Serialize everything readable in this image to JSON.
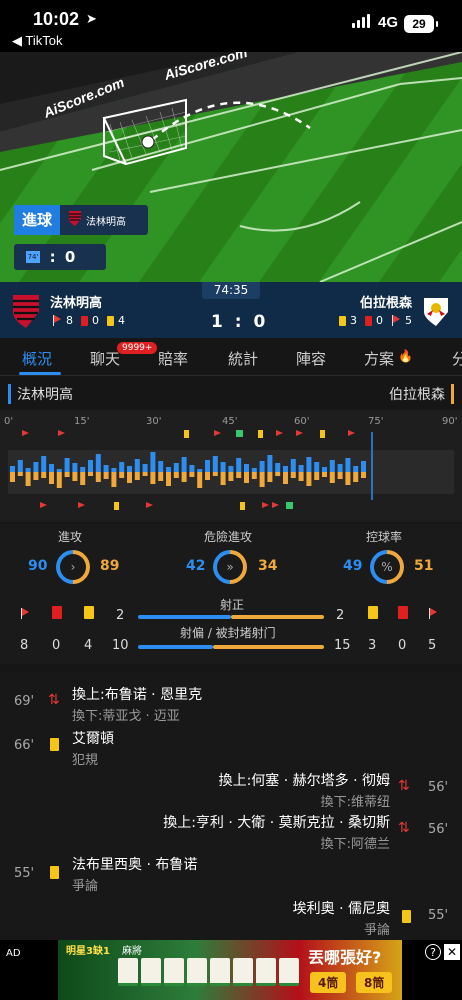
{
  "status": {
    "time": "10:02",
    "back": "◀ TikTok",
    "network": "4G",
    "battery": "29"
  },
  "pitch": {
    "brand_top": "AiScore.com",
    "brand_left": "AiScore.com",
    "event_label": "進球",
    "event_team": "法林明高",
    "minute_badge": "74'",
    "mini_score": "1 : 0"
  },
  "match": {
    "clock": "74:35",
    "home": "法林明高",
    "away": "伯拉根森",
    "score": "1 : 0",
    "home_corners": "8",
    "home_reds": "0",
    "home_yellows": "4",
    "away_yellows": "3",
    "away_reds": "0",
    "away_corners": "5"
  },
  "tabs": [
    {
      "label": "概況"
    },
    {
      "label": "聊天"
    },
    {
      "label": "賠率"
    },
    {
      "label": "統計"
    },
    {
      "label": "陣容"
    },
    {
      "label": "方案"
    },
    {
      "label": "分"
    }
  ],
  "chat_badge": "9999+",
  "teams": {
    "home": "法林明高",
    "away": "伯拉根森"
  },
  "timeline": {
    "ticks": [
      "0'",
      "15'",
      "30'",
      "45'",
      "60'",
      "75'",
      "90'"
    ]
  },
  "stats": {
    "attack": {
      "label": "進攻",
      "home": "90",
      "away": "89"
    },
    "danger": {
      "label": "危險進攻",
      "home": "42",
      "away": "34"
    },
    "possession": {
      "label": "控球率",
      "home": "49",
      "away": "51"
    },
    "on_target": {
      "label": "射正",
      "home": "2",
      "away": "2"
    },
    "off_target": {
      "label": "射偏 / 被封堵射门",
      "home": "10",
      "away": "15"
    },
    "home_counts": {
      "corners": "8",
      "reds": "0",
      "yellows": "4"
    },
    "away_counts": {
      "yellows": "3",
      "reds": "0",
      "corners": "5"
    }
  },
  "events": [
    {
      "minute": "69'",
      "line1": "換上:布鲁诺 · 恩里克",
      "line2": "換下:蒂亚戈 · 迈亚"
    },
    {
      "minute": "66'",
      "line1": "艾爾頓",
      "line2": "犯規"
    },
    {
      "minute": "56'",
      "line1": "換上:何塞 · 赫尔塔多 · 彻姆",
      "line2": "換下:维蒂纽"
    },
    {
      "minute": "56'",
      "line1": "換上:亨利 · 大衛 · 莫斯克拉 · 桑切斯",
      "line2": "換下:阿德兰"
    },
    {
      "minute": "55'",
      "line1": "法布里西奥 · 布鲁诺",
      "line2": "爭論"
    },
    {
      "minute": "55'",
      "line1": "埃利奧 · 儒尼奧",
      "line2": "爭論"
    }
  ],
  "ad": {
    "label": "AD",
    "title": "丟哪張好?",
    "opt1": "4筒",
    "opt2": "8筒",
    "logo": "明星3缺1",
    "tag": "麻將"
  }
}
